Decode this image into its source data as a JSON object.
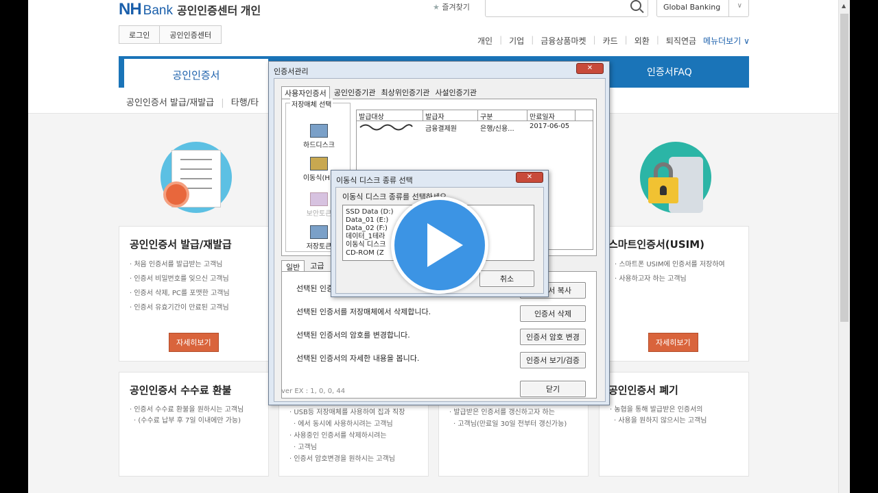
{
  "header": {
    "logo_nh": "NH",
    "logo_bank": "Bank",
    "logo_center": "공인인증센터 개인",
    "favorites": "즐겨찾기",
    "global_banking": "Global Banking",
    "tab_login": "로그인",
    "tab_cert_center": "공인인증센터",
    "nav": [
      "개인",
      "기업",
      "금융상품마켓",
      "카드",
      "외환",
      "퇴직연금"
    ],
    "nav_more": "메뉴더보기"
  },
  "bluebar": {
    "active_tab": "공인인증서",
    "faq_tab": "인증서FAQ"
  },
  "subnav": {
    "items": [
      "공인인증서 발급/재발급",
      "타행/타"
    ]
  },
  "cards": {
    "issue": {
      "title": "공인인증서 발급/재발급",
      "items": [
        "처음 인증서를 발급받는 고객님",
        "인증서 비밀번호를 잊으신 고객님",
        "인증서 삭제, PC를 포맷한 고객님",
        "인증서 유효기간이 만료된 고객님"
      ],
      "button": "자세히보기"
    },
    "usim": {
      "title": "스마트인증서(USIM)",
      "items": [
        "스마트폰 USIM에 인증서를 저장하여",
        "사용하고자 하는 고객님"
      ],
      "button": "자세히보기"
    },
    "refund": {
      "title": "공인인증서 수수료 환불",
      "items": [
        "인증서 수수료 환불을 원하시는 고객님",
        "(수수료 납부 후 7일 이내에만 가능)"
      ]
    },
    "manage": {
      "items": [
        "USB등 저장매체를 사용하여 집과 직장",
        "에서 동시에 사용하시려는 고객님",
        "사용중인 인증서를 삭제하시려는",
        "고객님",
        "인증서 암호변경을 원하시는 고객님"
      ]
    },
    "renew": {
      "items": [
        "발급받은 인증서를 갱신하고자 하는",
        "고객님(만료일 30일 전부터 갱신가능)"
      ]
    },
    "revoke": {
      "title": "공인인증서 폐기",
      "items": [
        "농협을 통해 발급받은 인증서의",
        "사용을 원하지 않으시는 고객님"
      ]
    }
  },
  "cert_dialog": {
    "title": "인증서관리",
    "tabs": [
      "사용자인증서",
      "공인인증기관",
      "최상위인증기관",
      "사설인증기관"
    ],
    "storage_legend": "저장매체 선택",
    "devices": [
      {
        "label": "하드디스크",
        "state": "normal"
      },
      {
        "label": "이동식(H:)",
        "state": "selected"
      },
      {
        "label": "보안토큰",
        "state": "disabled"
      },
      {
        "label": "저장토큰",
        "state": "normal"
      }
    ],
    "columns": [
      "발급대상",
      "발급자",
      "구분",
      "만료일자"
    ],
    "rows": [
      {
        "subject": "",
        "issuer": "금융결제원",
        "type": "은행/신용...",
        "expiry": "2017-06-05"
      }
    ],
    "subtabs": [
      "일반",
      "고급"
    ],
    "actions": [
      {
        "text": "선택된 인증서를",
        "button": "인증서 복사"
      },
      {
        "text": "선택된 인증서를 저장매체에서 삭제합니다.",
        "button": "인증서 삭제"
      },
      {
        "text": "선택된 인증서의 암호를 변경합니다.",
        "button": "인증서 암호 변경"
      },
      {
        "text": "선택된 인증서의 자세한 내용을 봅니다.",
        "button": "인증서 보기/검증"
      }
    ],
    "version": "ver EX : 1, 0, 0, 44",
    "close_button": "닫기"
  },
  "disk_dialog": {
    "title": "이동식 디스크 종류 선택",
    "prompt": "이동식 디스크 종류를 선택하세요.",
    "options": [
      "SSD Data (D:)",
      "Data_01 (E:)",
      "Data_02 (F:)",
      "데이터_1테라",
      "이동식 디스크",
      "CD-ROM (Z"
    ],
    "cancel_button": "취소"
  },
  "colors": {
    "brand_blue": "#1a74b8",
    "button_orange": "#d9643c",
    "play_blue": "#3c94e4"
  }
}
